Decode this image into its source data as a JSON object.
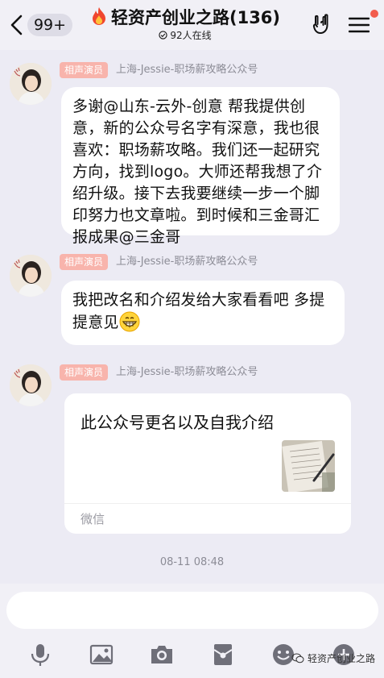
{
  "header": {
    "unread_count": "99+",
    "title": "轻资产创业之路(136)",
    "online": "92人在线"
  },
  "messages": [
    {
      "role": "相声演员",
      "sender": "上海-Jessie-职场薪攻略公众号",
      "text": "多谢@山东-云外-创意 帮我提供创意，新的公众号名字有深意，我也很喜欢：职场薪攻略。我们还一起研究方向，找到logo。大师还帮我想了介绍升级。接下去我要继续一步一个脚印努力也文章啦。到时候和三金哥汇报成果@三金哥"
    },
    {
      "role": "相声演员",
      "sender": "上海-Jessie-职场薪攻略公众号",
      "text": "我把改名和介绍发给大家看看吧 多提提意见"
    },
    {
      "role": "相声演员",
      "sender": "上海-Jessie-职场薪攻略公众号",
      "card_title": "此公众号更名以及自我介绍",
      "card_source": "微信"
    }
  ],
  "timestamp": "08-11 08:48",
  "input": {
    "placeholder": ""
  },
  "toolbar": [
    "mic-icon",
    "image-icon",
    "camera-icon",
    "red-packet-icon",
    "emoji-icon",
    "plus-icon"
  ],
  "watermark": "轻资产创业之路",
  "colors": {
    "role_badge": "#F8B4AC",
    "background": "#ECEBF4",
    "red_dot": "#F25C4D"
  }
}
